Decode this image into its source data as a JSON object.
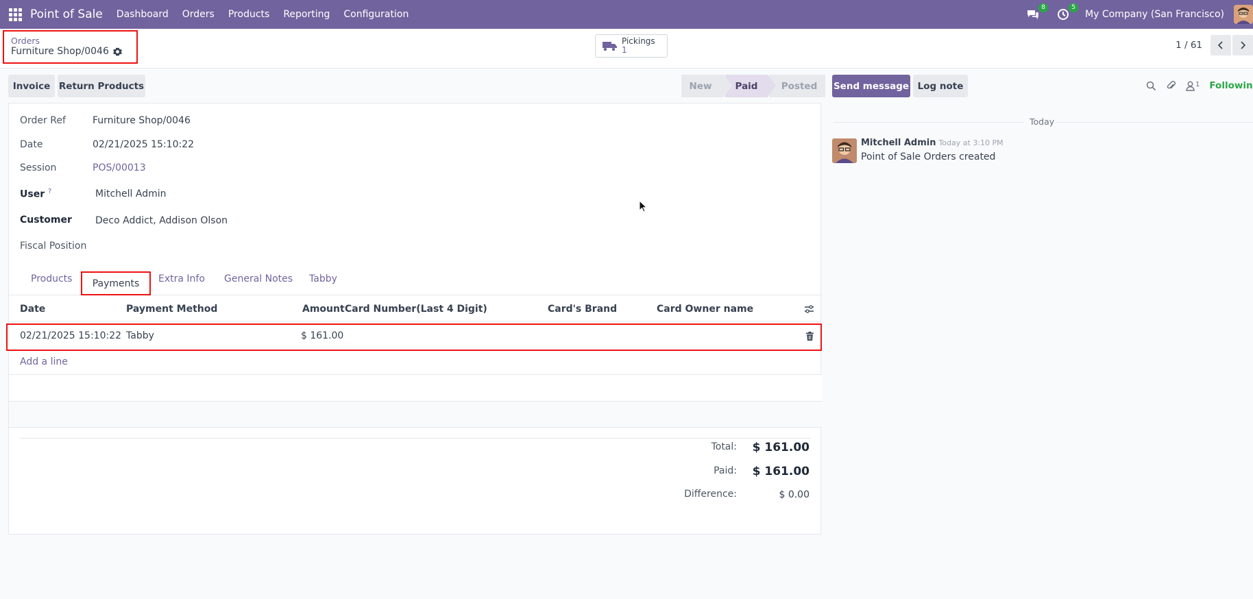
{
  "navbar": {
    "app_name": "Point of Sale",
    "menu": [
      "Dashboard",
      "Orders",
      "Products",
      "Reporting",
      "Configuration"
    ],
    "messages_badge": "8",
    "activities_badge": "5",
    "company": "My Company (San Francisco)",
    "color": "#71639e"
  },
  "breadcrumb": {
    "parent": "Orders",
    "current": "Furniture Shop/0046"
  },
  "smart_button": {
    "label": "Pickings",
    "count": "1"
  },
  "pager": {
    "value": "1 / 61"
  },
  "actions": {
    "invoice": "Invoice",
    "return_products": "Return Products"
  },
  "statusbar": {
    "new": "New",
    "paid": "Paid",
    "posted": "Posted",
    "active": "Paid"
  },
  "form": {
    "order_ref_label": "Order Ref",
    "order_ref": "Furniture Shop/0046",
    "date_label": "Date",
    "date": "02/21/2025 15:10:22",
    "session_label": "Session",
    "session": "POS/00013",
    "user_label": "User",
    "user_help": "?",
    "user": "Mitchell Admin",
    "customer_label": "Customer",
    "customer": "Deco Addict, Addison Olson",
    "fiscal_label": "Fiscal Position"
  },
  "tabs": {
    "products": "Products",
    "payments": "Payments",
    "extra": "Extra Info",
    "notes": "General Notes",
    "tabby": "Tabby"
  },
  "payments_table": {
    "headers": {
      "date": "Date",
      "method": "Payment Method",
      "amount": "Amount",
      "card": "Card Number(Last 4 Digit)",
      "brand": "Card's Brand",
      "owner": "Card Owner name"
    },
    "rows": [
      {
        "date": "02/21/2025 15:10:22",
        "method": "Tabby",
        "amount": "$ 161.00",
        "card": "",
        "brand": "",
        "owner": ""
      }
    ],
    "add_line": "Add a line"
  },
  "totals": {
    "total_label": "Total:",
    "total": "$ 161.00",
    "paid_label": "Paid:",
    "paid": "$ 161.00",
    "difference_label": "Difference:",
    "difference": "$ 0.00"
  },
  "chatter": {
    "send_message": "Send message",
    "log_note": "Log note",
    "followers_count": "1",
    "following": "Following",
    "date_separator": "Today",
    "messages": [
      {
        "author": "Mitchell Admin",
        "time": "Today at 3:10 PM",
        "body": "Point of Sale Orders created"
      }
    ]
  }
}
